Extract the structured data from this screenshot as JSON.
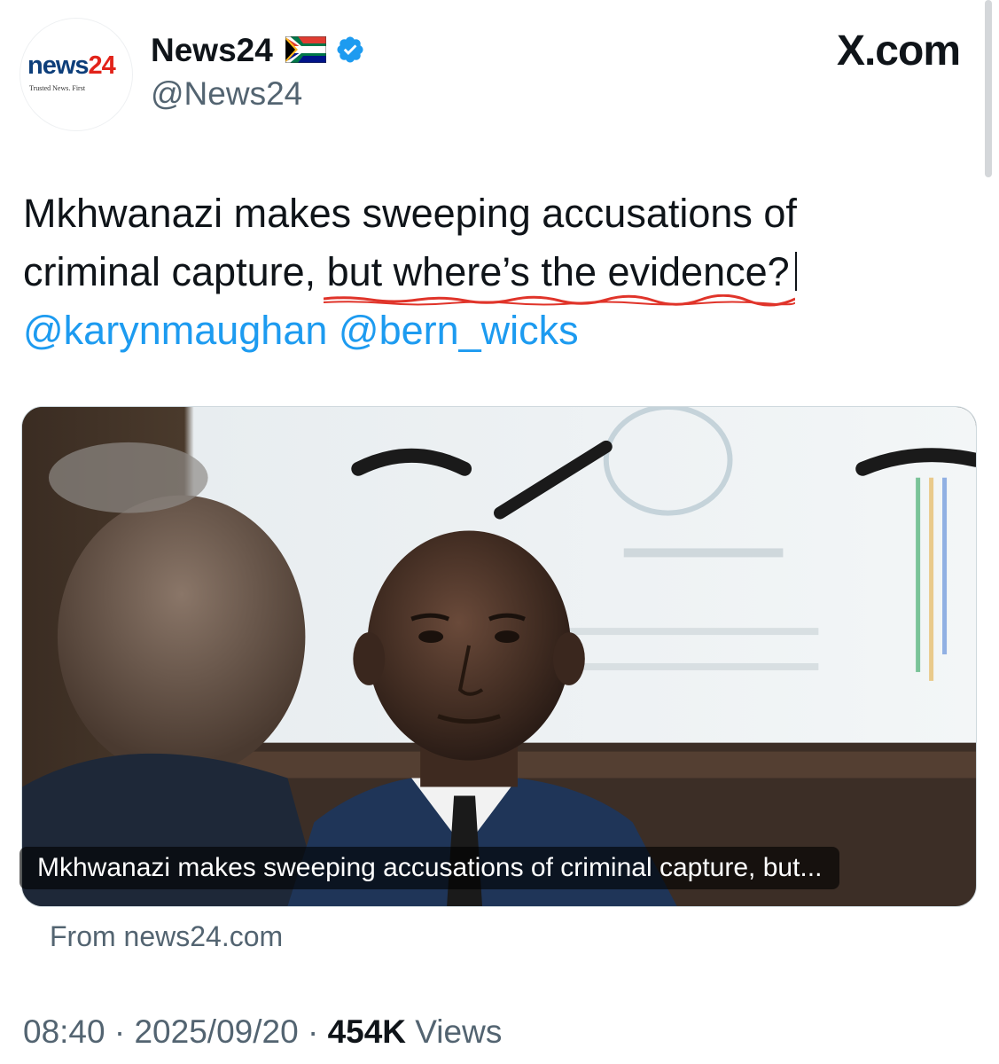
{
  "header": {
    "logo": {
      "word_news": "news",
      "word_24": "24",
      "tagline": "Trusted News. First"
    },
    "display_name": "News24",
    "handle": "@News24",
    "site_brand": "X.com",
    "flag_icon": "south-africa-flag-icon",
    "verified_icon": "verified-badge-icon",
    "verified_color": "#1d9bf0"
  },
  "tweet": {
    "text_part1": "Mkhwanazi makes sweeping accusations of criminal capture, ",
    "text_underlined": "but where’s the evidence?",
    "mentions": [
      "@karynmaughan",
      "@bern_wicks"
    ],
    "underline_color": "#e0342a",
    "mention_color": "#1d9bf0"
  },
  "card": {
    "caption": "Mkhwanazi makes sweeping accusations of criminal capture, but...",
    "source": "From news24.com"
  },
  "meta": {
    "time": "08:40",
    "separator": "·",
    "date": "2025/09/20",
    "views_count": "454K",
    "views_label": "Views"
  }
}
